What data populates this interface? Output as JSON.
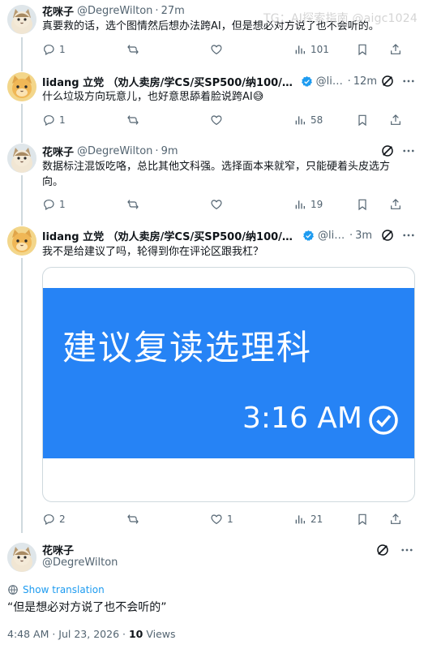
{
  "watermark": "TG：AI探索指南 @aigc1024",
  "replies": [
    {
      "name": "花咪子",
      "handle": "@DegreWilton",
      "time": "27m",
      "text": "真要救的话，选个图情然后想办法跨AI，但是想必对方说了也不会听的。",
      "stats": {
        "replies": "1",
        "retweets": "",
        "likes": "",
        "views": "101"
      }
    },
    {
      "name": "lidang 立党 （劝人卖房/学CS/买SP500/纳100/O…",
      "handle": "@lid…",
      "time": "12m",
      "text": "什么垃圾方向玩意儿，也好意思舔着脸说跨AI😅",
      "stats": {
        "replies": "1",
        "retweets": "",
        "likes": "",
        "views": "58"
      }
    },
    {
      "name": "花咪子",
      "handle": "@DegreWilton",
      "time": "9m",
      "text": "数据标注混饭吃咯，总比其他文科强。选择面本来就窄，只能硬着头皮选方向。",
      "stats": {
        "replies": "1",
        "retweets": "",
        "likes": "",
        "views": "19"
      }
    },
    {
      "name": "lidang 立党 （劝人卖房/学CS/买SP500/纳100/O…",
      "handle": "@lid…",
      "time": "3m",
      "text": "我不是给建议了吗，轮得到你在评论区跟我杠？",
      "image": {
        "headline": "建议复读选理科",
        "clock": "3:16 AM"
      },
      "stats": {
        "replies": "2",
        "retweets": "",
        "likes": "1",
        "views": "21"
      }
    }
  ],
  "main_tweet": {
    "name": "花咪子",
    "handle": "@DegreWilton",
    "translate_label": "Show translation",
    "text": "“但是想必对方说了也不会听的”",
    "timestamp": "4:48 AM · Jul 23, 2026 · ",
    "views_count": "10",
    "views_label": " Views"
  },
  "colors": {
    "accent": "#1d9bf0",
    "muted": "#536471",
    "image_blue": "#2683f5",
    "verified": "#1d9bf0"
  }
}
